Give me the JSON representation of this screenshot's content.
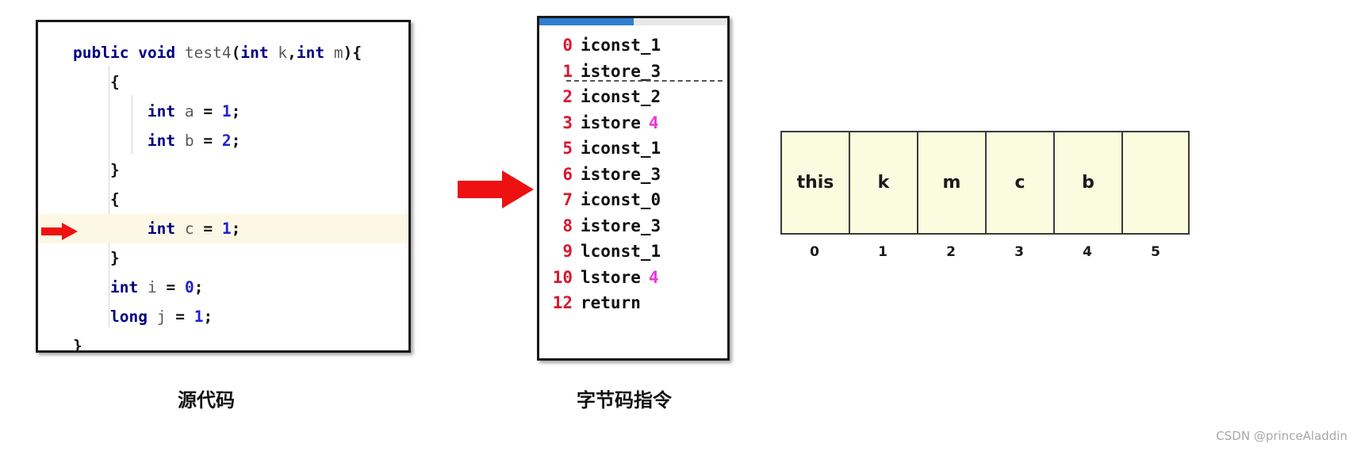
{
  "source_panel": {
    "caption": "源代码",
    "lines": [
      {
        "indent": 0,
        "tokens": [
          {
            "t": "public",
            "c": "kw"
          },
          {
            "t": " ",
            "c": "pl"
          },
          {
            "t": "void",
            "c": "kw"
          },
          {
            "t": " ",
            "c": "pl"
          },
          {
            "t": "test4",
            "c": "id"
          },
          {
            "t": "(",
            "c": "pl"
          },
          {
            "t": "int",
            "c": "kw"
          },
          {
            "t": " ",
            "c": "pl"
          },
          {
            "t": "k",
            "c": "id"
          },
          {
            "t": ",",
            "c": "pl"
          },
          {
            "t": "int",
            "c": "kw"
          },
          {
            "t": " ",
            "c": "pl"
          },
          {
            "t": "m",
            "c": "id"
          },
          {
            "t": "){",
            "c": "pl"
          }
        ],
        "highlight": false,
        "arrow": false
      },
      {
        "indent": 1,
        "tokens": [
          {
            "t": "{",
            "c": "pl"
          }
        ],
        "highlight": false,
        "arrow": false
      },
      {
        "indent": 2,
        "tokens": [
          {
            "t": "int",
            "c": "kw"
          },
          {
            "t": " ",
            "c": "pl"
          },
          {
            "t": "a",
            "c": "id"
          },
          {
            "t": " ",
            "c": "pl"
          },
          {
            "t": "=",
            "c": "pl"
          },
          {
            "t": " ",
            "c": "pl"
          },
          {
            "t": "1",
            "c": "num"
          },
          {
            "t": ";",
            "c": "pl"
          }
        ],
        "highlight": false,
        "arrow": false
      },
      {
        "indent": 2,
        "tokens": [
          {
            "t": "int",
            "c": "kw"
          },
          {
            "t": " ",
            "c": "pl"
          },
          {
            "t": "b",
            "c": "id"
          },
          {
            "t": " ",
            "c": "pl"
          },
          {
            "t": "=",
            "c": "pl"
          },
          {
            "t": " ",
            "c": "pl"
          },
          {
            "t": "2",
            "c": "num"
          },
          {
            "t": ";",
            "c": "pl"
          }
        ],
        "highlight": false,
        "arrow": false
      },
      {
        "indent": 1,
        "tokens": [
          {
            "t": "}",
            "c": "pl"
          }
        ],
        "highlight": false,
        "arrow": false
      },
      {
        "indent": 1,
        "tokens": [
          {
            "t": "{",
            "c": "pl"
          }
        ],
        "highlight": false,
        "arrow": false
      },
      {
        "indent": 2,
        "tokens": [
          {
            "t": "int",
            "c": "kw"
          },
          {
            "t": " ",
            "c": "pl"
          },
          {
            "t": "c",
            "c": "id"
          },
          {
            "t": " ",
            "c": "pl"
          },
          {
            "t": "=",
            "c": "pl"
          },
          {
            "t": " ",
            "c": "pl"
          },
          {
            "t": "1",
            "c": "num"
          },
          {
            "t": ";",
            "c": "pl"
          }
        ],
        "highlight": true,
        "arrow": true
      },
      {
        "indent": 1,
        "tokens": [
          {
            "t": "}",
            "c": "pl"
          }
        ],
        "highlight": false,
        "arrow": false
      },
      {
        "indent": 1,
        "tokens": [
          {
            "t": "int",
            "c": "kw"
          },
          {
            "t": " ",
            "c": "pl"
          },
          {
            "t": "i",
            "c": "id"
          },
          {
            "t": " ",
            "c": "pl"
          },
          {
            "t": "=",
            "c": "pl"
          },
          {
            "t": " ",
            "c": "pl"
          },
          {
            "t": "0",
            "c": "num"
          },
          {
            "t": ";",
            "c": "pl"
          }
        ],
        "highlight": false,
        "arrow": false
      },
      {
        "indent": 1,
        "tokens": [
          {
            "t": "long",
            "c": "kw"
          },
          {
            "t": " ",
            "c": "pl"
          },
          {
            "t": "j",
            "c": "id"
          },
          {
            "t": " ",
            "c": "pl"
          },
          {
            "t": "=",
            "c": "pl"
          },
          {
            "t": " ",
            "c": "pl"
          },
          {
            "t": "1",
            "c": "num"
          },
          {
            "t": ";",
            "c": "pl"
          }
        ],
        "highlight": false,
        "arrow": false
      },
      {
        "indent": 0,
        "tokens": [
          {
            "t": "}",
            "c": "pl"
          }
        ],
        "highlight": false,
        "arrow": false
      }
    ]
  },
  "bytecode_panel": {
    "caption": "字节码指令",
    "instructions": [
      {
        "offset": "0",
        "op": "iconst_1",
        "arg": "",
        "dashed": false
      },
      {
        "offset": "1",
        "op": "istore_3",
        "arg": "",
        "dashed": true
      },
      {
        "offset": "2",
        "op": "iconst_2",
        "arg": "",
        "dashed": false
      },
      {
        "offset": "3",
        "op": "istore",
        "arg": "4",
        "dashed": false
      },
      {
        "offset": "5",
        "op": "iconst_1",
        "arg": "",
        "dashed": false
      },
      {
        "offset": "6",
        "op": "istore_3",
        "arg": "",
        "dashed": false
      },
      {
        "offset": "7",
        "op": "iconst_0",
        "arg": "",
        "dashed": false
      },
      {
        "offset": "8",
        "op": "istore_3",
        "arg": "",
        "dashed": false
      },
      {
        "offset": "9",
        "op": "lconst_1",
        "arg": "",
        "dashed": false
      },
      {
        "offset": "10",
        "op": "lstore",
        "arg": "4",
        "dashed": false
      },
      {
        "offset": "12",
        "op": "return",
        "arg": "",
        "dashed": false
      }
    ]
  },
  "slot_table": {
    "slots": [
      "this",
      "k",
      "m",
      "c",
      "b",
      ""
    ],
    "indices": [
      "0",
      "1",
      "2",
      "3",
      "4",
      "5"
    ]
  },
  "colors": {
    "accent_red": "#d6192e",
    "arrow_red": "#ee1111",
    "keyword_blue": "#000080",
    "operand_magenta": "#ef35d8",
    "slot_fill": "#fbfbe0",
    "highlight_row": "#fdf8e5",
    "scrollbar_blue": "#2f7fd1"
  },
  "watermark": "CSDN @princeAladdin"
}
